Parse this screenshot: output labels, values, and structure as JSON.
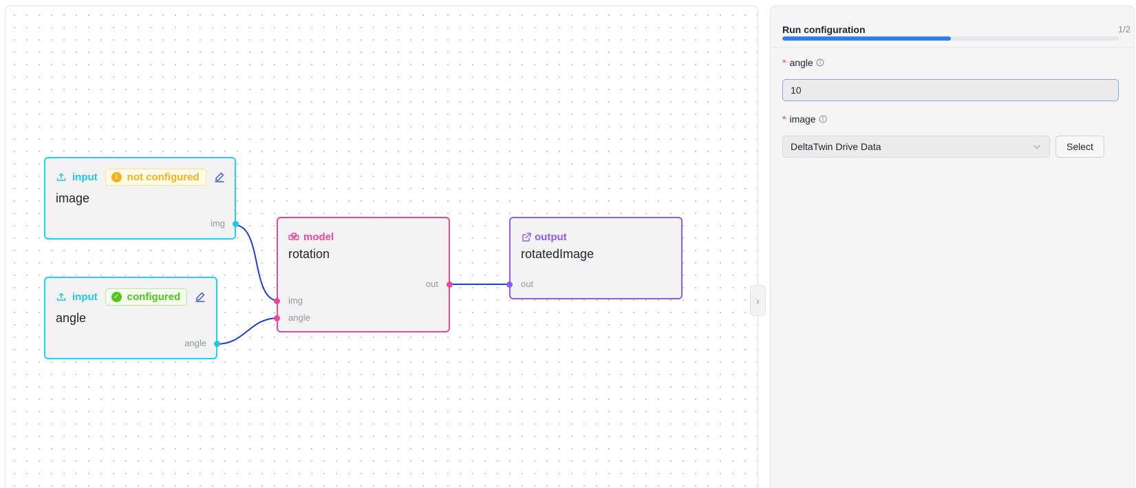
{
  "canvas": {
    "nodes": {
      "image_input": {
        "type_label": "input",
        "status": "not configured",
        "title": "image",
        "port_out": "img"
      },
      "angle_input": {
        "type_label": "input",
        "status": "configured",
        "title": "angle",
        "port_out": "angle"
      },
      "model": {
        "type_label": "model",
        "title": "rotation",
        "port_out": "out",
        "port_in_1": "img",
        "port_in_2": "angle"
      },
      "output": {
        "type_label": "output",
        "title": "rotatedImage",
        "port_in": "out"
      }
    },
    "colors": {
      "input": "#22d3ee",
      "model": "#ec4899",
      "output": "#8b5cf6",
      "edge": "#1d3fd6"
    }
  },
  "panel": {
    "title": "Run configuration",
    "step": "1/2",
    "progress": 0.5,
    "fields": {
      "angle": {
        "required_mark": "*",
        "label": "angle",
        "value": "10"
      },
      "image": {
        "required_mark": "*",
        "label": "image",
        "selected": "DeltaTwin Drive Data",
        "button": "Select"
      }
    }
  },
  "icons": {
    "input": "upload-icon",
    "model": "model-icon",
    "output": "external-link-icon",
    "edit": "edit-icon",
    "info": "info-icon",
    "collapse": "chevron-right-icon",
    "select": "chevron-down-icon"
  }
}
